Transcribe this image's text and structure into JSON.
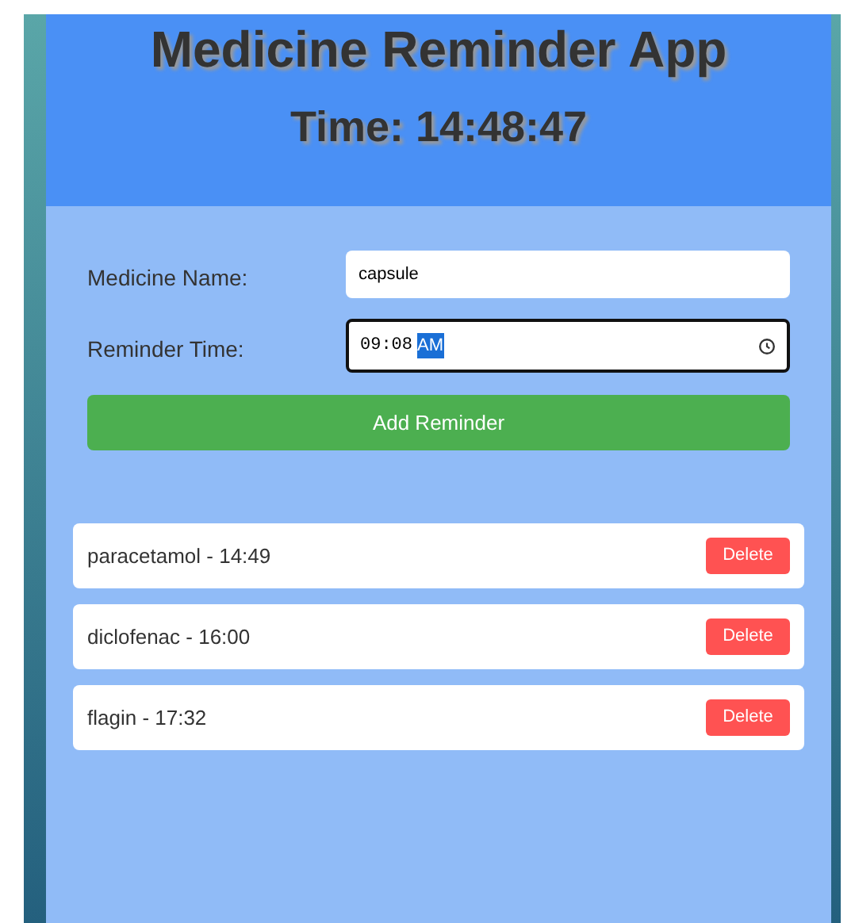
{
  "header": {
    "title": "Medicine Reminder App",
    "clock": "Time: 14:48:47"
  },
  "form": {
    "name_label": "Medicine Name:",
    "name_value": "capsule",
    "time_label": "Reminder Time:",
    "time_value": "09:08",
    "time_period": "AM",
    "period_selected": true,
    "time_focused": true,
    "submit": "Add Reminder"
  },
  "reminders": [
    {
      "text": "paracetamol - 14:49",
      "action": "Delete"
    },
    {
      "text": "diclofenac - 16:00",
      "action": "Delete"
    },
    {
      "text": "flagin - 17:32",
      "action": "Delete"
    }
  ]
}
